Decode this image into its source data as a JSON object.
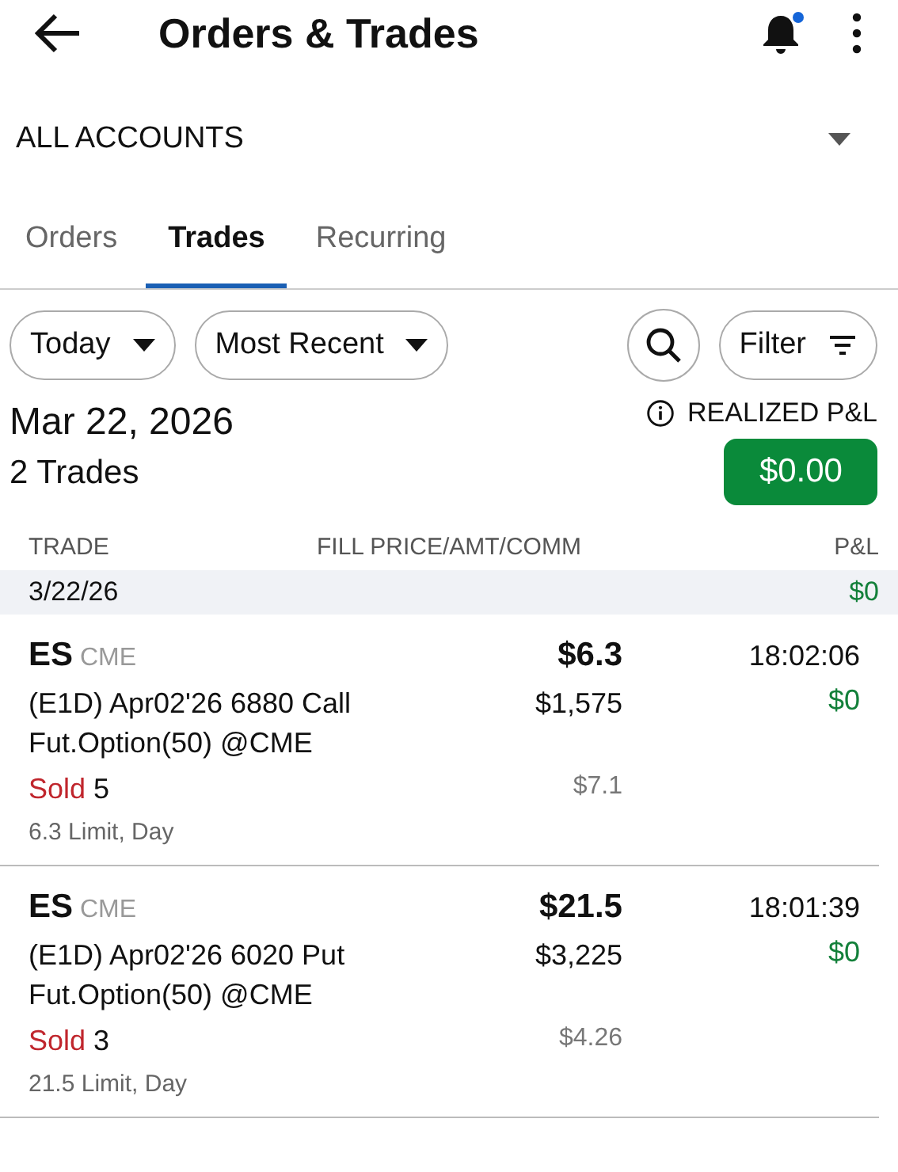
{
  "header": {
    "title": "Orders & Trades",
    "notification_dot": true
  },
  "account": {
    "label": "ALL ACCOUNTS"
  },
  "tabs": [
    {
      "label": "Orders",
      "selected": false
    },
    {
      "label": "Trades",
      "selected": true
    },
    {
      "label": "Recurring",
      "selected": false
    }
  ],
  "filters": [
    {
      "label": "Today"
    },
    {
      "label": "Most Recent"
    }
  ],
  "filter_button": {
    "label": "Filter"
  },
  "summary": {
    "date": "Mar 22, 2026",
    "count": "2 Trades",
    "realized_label": "REALIZED P&L",
    "realized_value": "$0.00"
  },
  "columns": [
    "TRADE",
    "FILL PRICE/AMT/COMM",
    "P&L"
  ],
  "date_band": {
    "date": "3/22/26",
    "pnl": "$0"
  },
  "trades": [
    {
      "symbol": "ES",
      "exchange": "CME",
      "price": "$6.3",
      "time": "18:02:06",
      "line1": "(E1D) Apr02'26 6880 Call",
      "line2": "Fut.Option(50) @CME",
      "amount": "$1,575",
      "pnl": "$0",
      "side": "Sold",
      "kind": "sell",
      "qty": "5",
      "comm": "$7.1",
      "order": "6.3 Limit, Day"
    },
    {
      "symbol": "ES",
      "exchange": "CME",
      "price": "$21.5",
      "time": "18:01:39",
      "line1": "(E1D) Apr02'26 6020 Put",
      "line2": "Fut.Option(50) @CME",
      "amount": "$3,225",
      "pnl": "$0",
      "side": "Sold",
      "kind": "sell",
      "qty": "3",
      "comm": "$4.26",
      "order": "21.5 Limit, Day"
    }
  ]
}
